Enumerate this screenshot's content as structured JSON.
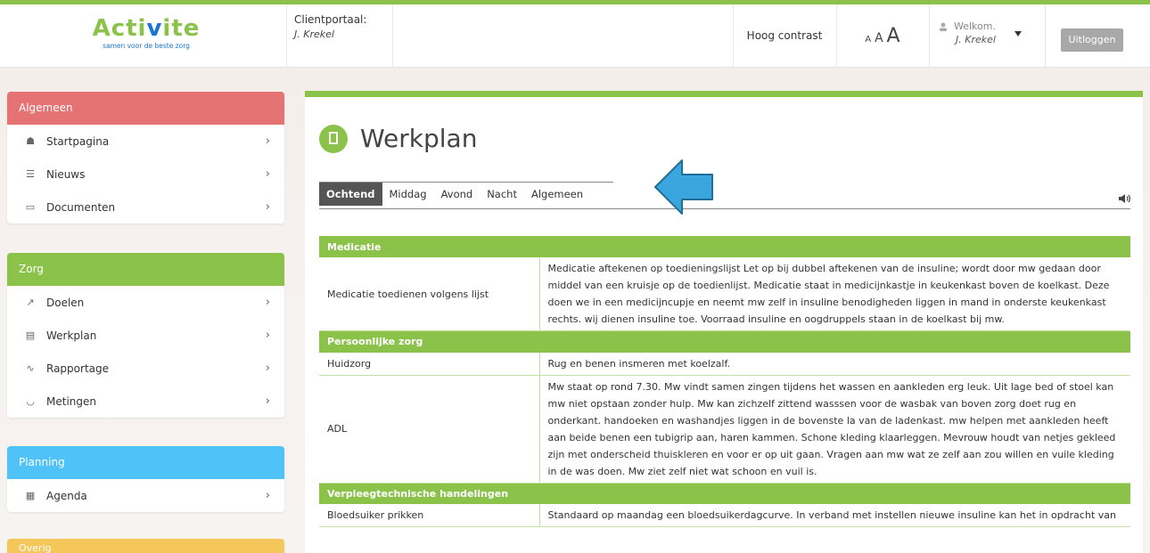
{
  "brand": {
    "logo_text_1": "Acti",
    "logo_text_v": "v",
    "logo_text_2": "ite",
    "tagline": "samen voor de beste zorg"
  },
  "header": {
    "client_label": "Clientportaal:",
    "client_name": "J. Krekel",
    "contrast_label": "Hoog contrast",
    "font_small": "A",
    "font_medium": "A",
    "font_large": "A",
    "welcome_label": "Welkom.",
    "welcome_name": "J. Krekel",
    "logout_label": "Uitloggen"
  },
  "sidebar": {
    "algemeen": {
      "title": "Algemeen",
      "color": "#e57373",
      "items": [
        {
          "label": "Startpagina",
          "icon": "home-icon"
        },
        {
          "label": "Nieuws",
          "icon": "list-icon"
        },
        {
          "label": "Documenten",
          "icon": "document-icon"
        }
      ]
    },
    "zorg": {
      "title": "Zorg",
      "color": "#8bc34a",
      "items": [
        {
          "label": "Doelen",
          "icon": "goal-icon"
        },
        {
          "label": "Werkplan",
          "icon": "clipboard-icon"
        },
        {
          "label": "Rapportage",
          "icon": "pulse-icon"
        },
        {
          "label": "Metingen",
          "icon": "gauge-icon"
        }
      ]
    },
    "planning": {
      "title": "Planning",
      "color": "#4fc3f7",
      "items": [
        {
          "label": "Agenda",
          "icon": "calendar-icon"
        }
      ]
    },
    "overig": {
      "title": "Overig",
      "color": "#f5c75a"
    }
  },
  "main": {
    "title": "Werkplan",
    "accent_color": "#8bc34a",
    "tabs": [
      {
        "label": "Ochtend",
        "active": true
      },
      {
        "label": "Middag"
      },
      {
        "label": "Avond"
      },
      {
        "label": "Nacht"
      },
      {
        "label": "Algemeen"
      }
    ],
    "sections": [
      {
        "title": "Medicatie",
        "rows": [
          {
            "label": "Medicatie toedienen volgens lijst",
            "text": "Medicatie aftekenen op toedieningslijst Let op bij dubbel aftekenen van de insuline; wordt door mw gedaan door middel van een kruisje op de toedienlijst. Medicatie staat in medicijnkastje in keukenkast boven de koelkast. Deze doen we in een medicijncupje en neemt mw zelf in insuline benodigheden liggen in mand in onderste keukenkast rechts. wij dienen insuline toe. Voorraad insuline en oogdruppels staan in de koelkast bij mw."
          }
        ]
      },
      {
        "title": "Persoonlijke zorg",
        "rows": [
          {
            "label": "Huidzorg",
            "text": "Rug en benen insmeren met koelzalf."
          },
          {
            "label": "ADL",
            "text": "Mw staat op rond 7.30. Mw vindt samen zingen tijdens het wassen en aankleden erg leuk. Uit lage bed of stoel kan mw niet opstaan zonder hulp. Mw kan zichzelf zittend wasssen voor de wasbak van boven zorg doet rug en onderkant. handoeken en washandjes liggen in de bovenste la van de ladenkast. mw helpen met aankleden heeft aan beide benen een tubigrip aan, haren kammen. Schone kleding klaarleggen. Mevrouw houdt van netjes gekleed zijn met onderscheid thuiskleren en voor er op uit gaan. Vragen aan mw wat ze zelf aan zou willen en vuile kleding in de was doen. Mw ziet zelf niet wat schoon en vuil is."
          }
        ]
      },
      {
        "title": "Verpleegtechnische handelingen",
        "rows": [
          {
            "label": "Bloedsuiker prikken",
            "text": "Standaard op maandag een bloedsuikerdagcurve. In verband met instellen nieuwe insuline kan het in opdracht van"
          }
        ]
      }
    ]
  },
  "annotation": {
    "arrow_color": "#3aa6dd"
  }
}
